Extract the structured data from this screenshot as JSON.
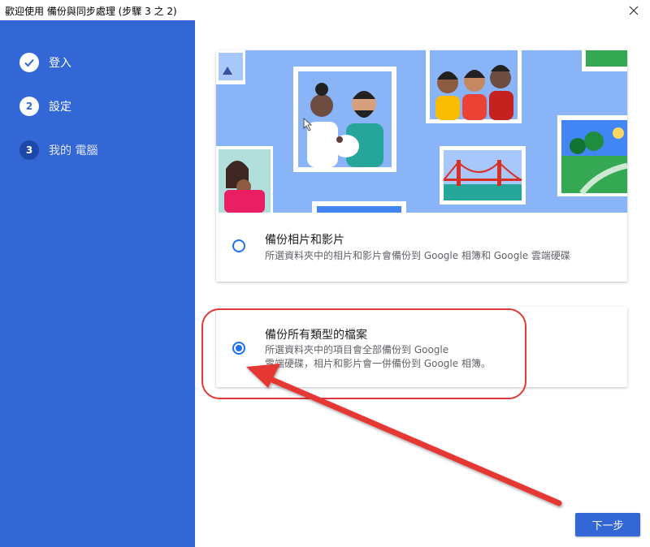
{
  "window": {
    "title": "歡迎使用 備份與同步處理 (步驟 3 之 2)",
    "close_icon": "close-icon"
  },
  "sidebar": {
    "steps": [
      {
        "marker": "",
        "label": "登入",
        "state": "done",
        "icon": "checkmark-icon"
      },
      {
        "marker": "2",
        "label": "設定",
        "state": "active"
      },
      {
        "marker": "3",
        "label": "我的 電腦",
        "state": "todo"
      }
    ]
  },
  "options": [
    {
      "title": "備份相片和影片",
      "desc_line1": "所選資料夾中的相片和影片會備份到 Google 相簿和 Google 雲端硬碟",
      "desc_line2": "",
      "selected": false
    },
    {
      "title": "備份所有類型的檔案",
      "desc_line1": "所選資料夾中的項目會全部備份到 Google",
      "desc_line2": "雲端硬碟，相片和影片會一併備份到 Google 相簿。",
      "selected": true
    }
  ],
  "footer": {
    "next_label": "下一步"
  },
  "colors": {
    "sidebar": "#3367d6",
    "accent": "#1a73e8",
    "annotation": "#e0393b",
    "hero_bg": "#8ab4f8"
  }
}
